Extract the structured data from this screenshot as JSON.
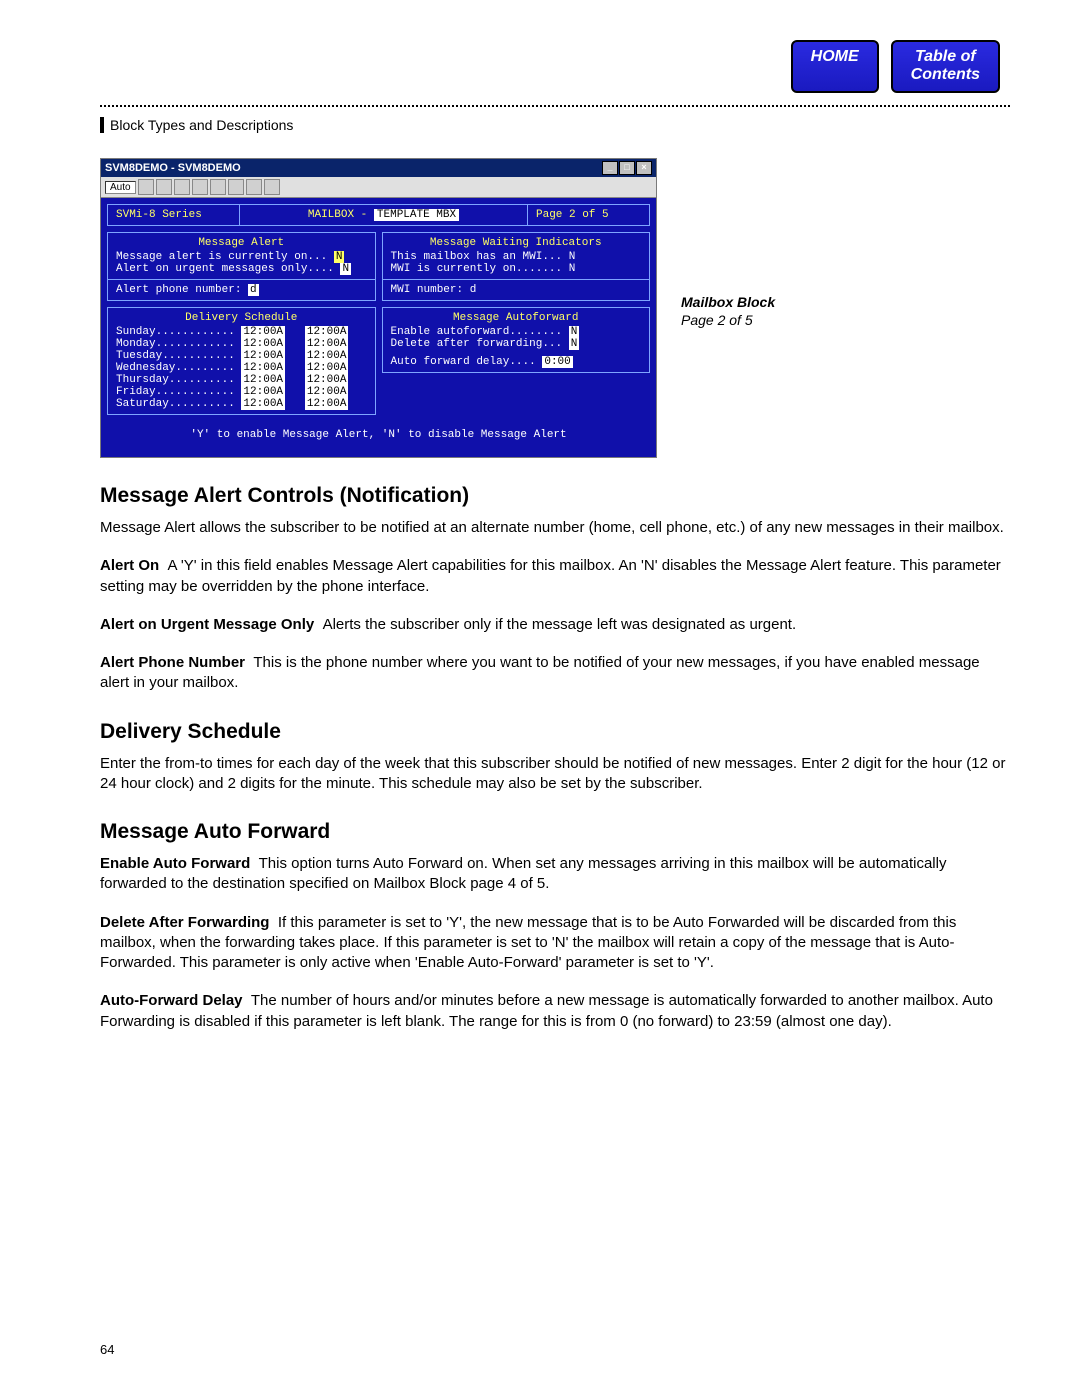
{
  "nav": {
    "home": "HOME",
    "toc_l1": "Table of",
    "toc_l2": "Contents"
  },
  "breadcrumb": "Block Types and Descriptions",
  "window": {
    "title": "SVM8DEMO - SVM8DEMO",
    "toolbar_label": "Auto",
    "header": {
      "left": "SVMi-8 Series",
      "mid_label": "MAILBOX - ",
      "mid_value": "TEMPLATE MBX",
      "right": "Page 2 of 5"
    },
    "msg_alert": {
      "title": "Message Alert",
      "l1": "Message alert is currently on...",
      "v1": "N",
      "l2": "Alert on urgent messages only....",
      "v2": "N",
      "l3": "Alert phone number:",
      "v3": "d"
    },
    "mwi": {
      "title": "Message Waiting Indicators",
      "l1": "This mailbox has an MWI...",
      "v1": "N",
      "l2": "MWI is currently on.......",
      "v2": "N",
      "l3": "MWI number:",
      "v3": "d"
    },
    "schedule": {
      "title": "Delivery Schedule",
      "rows": [
        {
          "d": "Sunday............",
          "a": "12:00A",
          "b": "12:00A"
        },
        {
          "d": "Monday............",
          "a": "12:00A",
          "b": "12:00A"
        },
        {
          "d": "Tuesday...........",
          "a": "12:00A",
          "b": "12:00A"
        },
        {
          "d": "Wednesday.........",
          "a": "12:00A",
          "b": "12:00A"
        },
        {
          "d": "Thursday..........",
          "a": "12:00A",
          "b": "12:00A"
        },
        {
          "d": "Friday............",
          "a": "12:00A",
          "b": "12:00A"
        },
        {
          "d": "Saturday..........",
          "a": "12:00A",
          "b": "12:00A"
        }
      ]
    },
    "autofwd": {
      "title": "Message Autoforward",
      "l1": "Enable autoforward........",
      "v1": "N",
      "l2": "Delete after forwarding...",
      "v2": "N",
      "l3": "Auto forward delay....",
      "v3": "0:00"
    },
    "footer": "'Y' to enable Message Alert, 'N' to disable Message Alert"
  },
  "caption": {
    "title": "Mailbox Block",
    "page": "Page 2 of 5"
  },
  "doc": {
    "h1": "Message Alert Controls (Notification)",
    "p1": "Message Alert allows the subscriber to be notified at an alternate number (home, cell phone, etc.) of any new messages in their mailbox.",
    "p2_lead": "Alert On",
    "p2_body": "A 'Y' in this field enables Message Alert capabilities for this mailbox. An 'N' disables the Message Alert feature. This parameter setting may be overridden by the phone interface.",
    "p3_lead": "Alert on Urgent Message Only",
    "p3_body": "Alerts the subscriber only if the message left was designated as urgent.",
    "p4_lead": "Alert Phone Number",
    "p4_body": "This is the phone number where you want to be notified of your new messages, if you have enabled message alert in your mailbox.",
    "h2": "Delivery Schedule",
    "p5": "Enter the from-to times for each day of the week that this subscriber should be notified of new messages. Enter 2 digit for the hour (12 or 24 hour clock) and 2 digits for the minute. This schedule may also be set by the subscriber.",
    "h3": "Message Auto Forward",
    "p6_lead": "Enable Auto Forward",
    "p6_body": "This option turns Auto Forward on. When set any messages arriving in this mailbox will be automatically forwarded to the destination specified on Mailbox Block page 4 of 5.",
    "p7_lead": "Delete After Forwarding",
    "p7_body": "If this parameter is set to 'Y', the new message that is to be Auto Forwarded will be discarded from this mailbox, when the forwarding takes place. If this parameter is set to 'N' the mailbox will retain a copy of the message that is Auto-Forwarded. This parameter is only active when 'Enable Auto-Forward' parameter is set to 'Y'.",
    "p8_lead": "Auto-Forward Delay",
    "p8_body": "The number of hours and/or minutes before a new message is automatically forwarded to another mailbox. Auto Forwarding is disabled if this parameter is left blank. The range for this is from 0 (no forward) to 23:59 (almost one day)."
  },
  "page_number": "64"
}
